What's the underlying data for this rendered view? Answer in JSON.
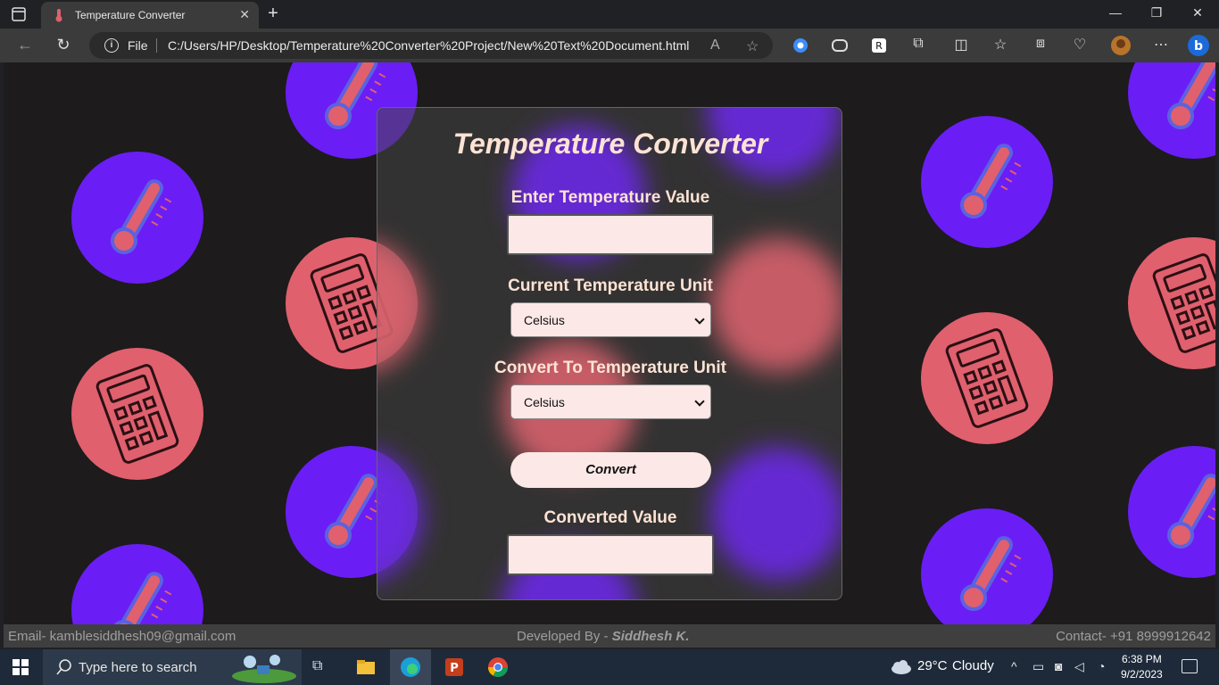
{
  "browser": {
    "tab_title": "Temperature Converter",
    "address_prefix": "File",
    "url": "C:/Users/HP/Desktop/Temperature%20Converter%20Project/New%20Text%20Document.html"
  },
  "converter": {
    "title": "Temperature Converter",
    "input_label": "Enter Temperature Value",
    "input_value": "",
    "from_label": "Current Temperature Unit",
    "from_selected": "Celsius",
    "to_label": "Convert To Temperature Unit",
    "to_selected": "Celsius",
    "convert_button": "Convert",
    "output_label": "Converted Value",
    "output_value": ""
  },
  "footer": {
    "email": "Email- kamblesiddhesh09@gmail.com",
    "developed_prefix": "Developed By -",
    "developer": "Siddhesh K.",
    "contact": "Contact- +91 8999912642"
  },
  "taskbar": {
    "search_placeholder": "Type here to search",
    "weather_temp": "29°C",
    "weather_text": "Cloudy",
    "time": "6:38 PM",
    "date": "9/2/2023"
  },
  "colors": {
    "accent_blue": "#6a1ef5",
    "accent_red": "#e0606e",
    "label_text": "#fde3d4",
    "input_bg": "#fce8e6"
  }
}
